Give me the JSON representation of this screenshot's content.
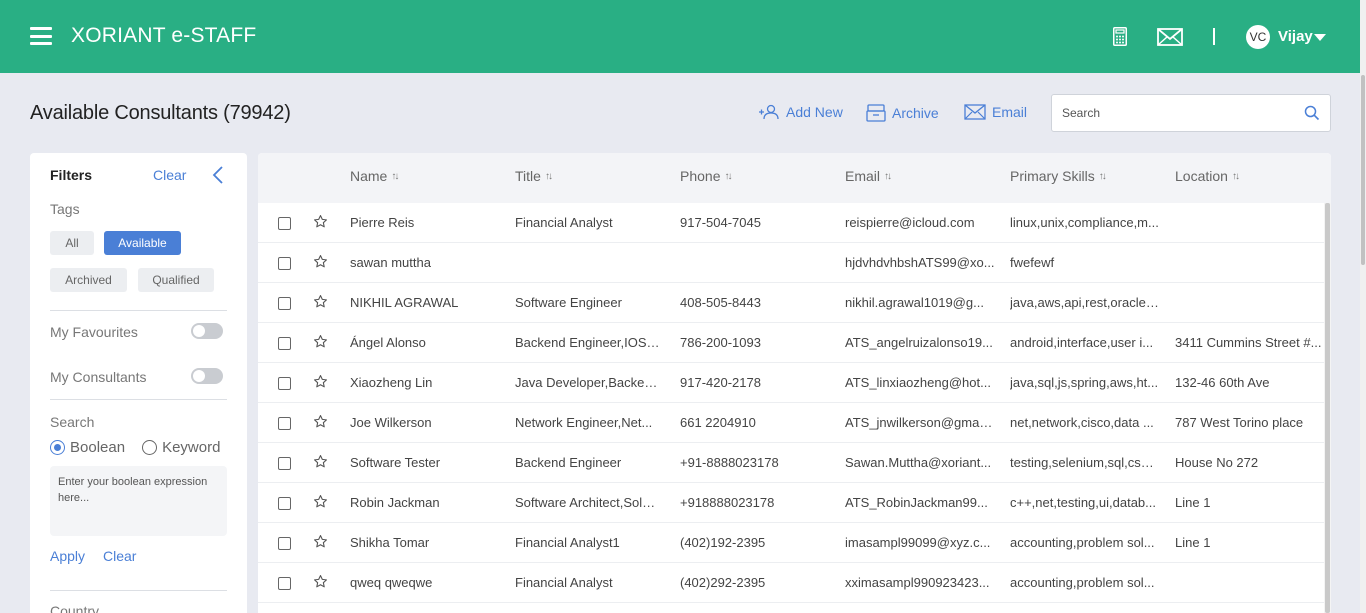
{
  "header": {
    "brand": "XORIANT e-STAFF",
    "user_initials": "VC",
    "user_name": "Vijay"
  },
  "toolbar": {
    "page_title": "Available Consultants (79942)",
    "add_new_label": "Add New",
    "archive_label": "Archive",
    "email_label": "Email",
    "search_placeholder": "Search"
  },
  "filters": {
    "title": "Filters",
    "clear_label": "Clear",
    "tags_label": "Tags",
    "tags": [
      {
        "label": "All",
        "active": false
      },
      {
        "label": "Available",
        "active": true
      },
      {
        "label": "Archived",
        "active": false
      },
      {
        "label": "Qualified",
        "active": false
      }
    ],
    "my_favourites_label": "My Favourites",
    "my_consultants_label": "My Consultants",
    "search_label": "Search",
    "boolean_label": "Boolean",
    "keyword_label": "Keyword",
    "boolean_placeholder": "Enter your boolean expression here...",
    "apply_label": "Apply",
    "clear_bottom_label": "Clear",
    "country_label": "Country"
  },
  "table": {
    "columns": [
      "Name",
      "Title",
      "Phone",
      "Email",
      "Primary Skills",
      "Location"
    ],
    "rows": [
      {
        "name": "Pierre Reis",
        "title": "Financial Analyst",
        "phone": "917-504-7045",
        "email": "reispierre@icloud.com",
        "skills": "linux,unix,compliance,m...",
        "location": ""
      },
      {
        "name": "sawan muttha",
        "title": "",
        "phone": "",
        "email": "hjdvhdvhbshATS99@xo...",
        "skills": "fwefewf",
        "location": ""
      },
      {
        "name": "NIKHIL AGRAWAL",
        "title": "Software Engineer",
        "phone": "408-505-8443",
        "email": "nikhil.agrawal1019@g...",
        "skills": "java,aws,api,rest,oracle,...",
        "location": ""
      },
      {
        "name": "Ángel Alonso",
        "title": "Backend Engineer,IOS ...",
        "phone": "786-200-1093",
        "email": "ATS_angelruizalonso19...",
        "skills": "android,interface,user i...",
        "location": "3411 Cummins Street #..."
      },
      {
        "name": "Xiaozheng Lin",
        "title": "Java Developer,Backen...",
        "phone": "917-420-2178",
        "email": "ATS_linxiaozheng@hot...",
        "skills": "java,sql,js,spring,aws,ht...",
        "location": "132-46 60th Ave"
      },
      {
        "name": "Joe Wilkerson",
        "title": "Network Engineer,Net...",
        "phone": "661 2204910",
        "email": "ATS_jnwilkerson@gmail...",
        "skills": "net,network,cisco,data ...",
        "location": "787 West Torino place"
      },
      {
        "name": "Software Tester",
        "title": "Backend Engineer",
        "phone": "+91-8888023178",
        "email": "Sawan.Muttha@xoriant...",
        "skills": "testing,selenium,sql,css,...",
        "location": "House No 272"
      },
      {
        "name": "Robin Jackman",
        "title": "Software Architect,Solu...",
        "phone": "+918888023178",
        "email": "ATS_RobinJackman99...",
        "skills": "c++,net,testing,ui,datab...",
        "location": "Line 1"
      },
      {
        "name": "Shikha Tomar",
        "title": "Financial Analyst1",
        "phone": "(402)192-2395",
        "email": "imasampl99099@xyz.c...",
        "skills": "accounting,problem sol...",
        "location": "Line 1"
      },
      {
        "name": "qweq qweqwe",
        "title": "Financial Analyst",
        "phone": "(402)292-2395",
        "email": "xximasampl990923423...",
        "skills": "accounting,problem sol...",
        "location": ""
      }
    ]
  },
  "colors": {
    "header_green": "#29af84",
    "accent_blue": "#4a7fd6",
    "page_bg": "#e8eaf1"
  }
}
